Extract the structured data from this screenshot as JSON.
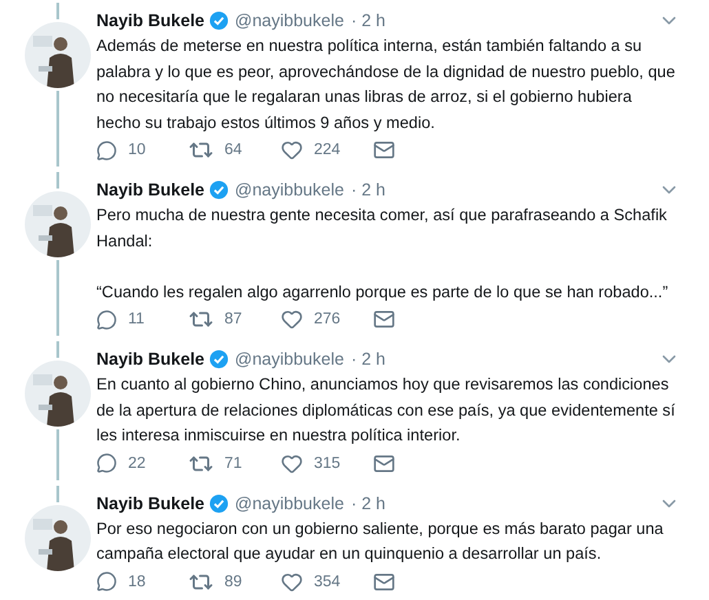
{
  "tweets": [
    {
      "name": "Nayib Bukele",
      "verified": true,
      "handle": "@nayibbukele",
      "time": "· 2 h",
      "thread_above": true,
      "thread_below": true,
      "paragraphs": [
        "Además de meterse en nuestra política interna, están también faltando a su palabra y lo que es peor, aprovechándose de la dignidad de nuestro pueblo, que no necesitaría que le regalaran unas libras de arroz, si el gobierno hubiera hecho su trabajo estos últimos 9 años y medio."
      ],
      "replies": "10",
      "retweets": "64",
      "likes": "224"
    },
    {
      "name": "Nayib Bukele",
      "verified": true,
      "handle": "@nayibbukele",
      "time": "· 2 h",
      "thread_above": true,
      "thread_below": true,
      "paragraphs": [
        "Pero mucha de nuestra gente necesita comer, así que parafraseando a Schafik Handal:",
        "“Cuando les regalen algo agarrenlo porque es parte de lo que se han robado...”"
      ],
      "replies": "11",
      "retweets": "87",
      "likes": "276"
    },
    {
      "name": "Nayib Bukele",
      "verified": true,
      "handle": "@nayibbukele",
      "time": "· 2 h",
      "thread_above": true,
      "thread_below": true,
      "paragraphs": [
        "En cuanto al gobierno Chino, anunciamos hoy que revisaremos las condiciones de la apertura de relaciones diplomáticas con ese país, ya que evidentemente sí les interesa inmiscuirse en nuestra política interior."
      ],
      "replies": "22",
      "retweets": "71",
      "likes": "315"
    },
    {
      "name": "Nayib Bukele",
      "verified": true,
      "handle": "@nayibbukele",
      "time": "· 2 h",
      "thread_above": true,
      "thread_below": false,
      "paragraphs": [
        "Por eso negociaron con un gobierno saliente, porque es más barato pagar una campaña electoral que ayudar en un quinquenio a desarrollar un país."
      ],
      "replies": "18",
      "retweets": "89",
      "likes": "354"
    }
  ]
}
